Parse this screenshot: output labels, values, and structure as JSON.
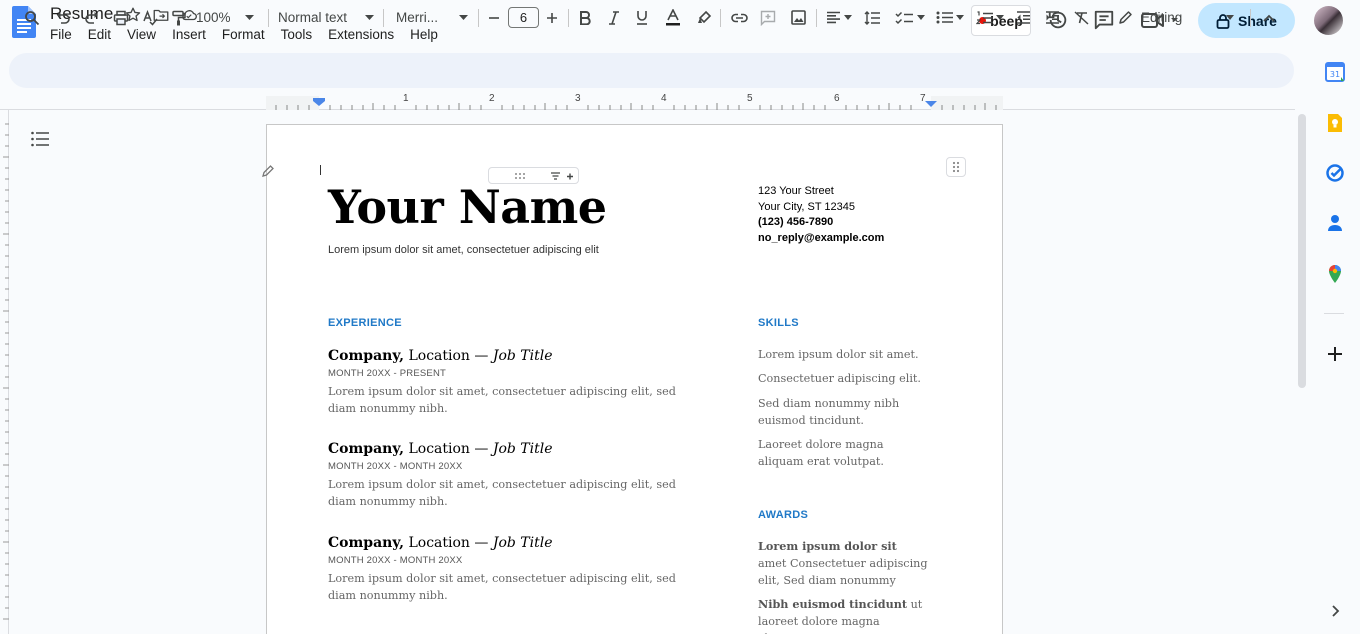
{
  "doc": {
    "title": "Resume",
    "menus": [
      "File",
      "Edit",
      "View",
      "Insert",
      "Format",
      "Tools",
      "Extensions",
      "Help"
    ]
  },
  "header": {
    "beep_label": "beep",
    "share_label": "Share"
  },
  "toolbar": {
    "zoom": "100%",
    "style": "Normal text",
    "font": "Merri...",
    "font_size": "6",
    "mode": "Editing"
  },
  "ruler": {
    "numbers": [
      "1",
      "2",
      "3",
      "4",
      "5",
      "6",
      "7"
    ]
  },
  "resume": {
    "name": "Your Name",
    "tagline": "Lorem ipsum dolor sit amet, consectetuer adipiscing elit",
    "address1": "123 Your Street",
    "address2": "Your City, ST 12345",
    "phone": "(123) 456-7890",
    "email": "no_reply@example.com",
    "experience_heading": "EXPERIENCE",
    "skills_heading": "SKILLS",
    "awards_heading": "AWARDS",
    "jobs": [
      {
        "company": "Company,",
        "location": " Location — ",
        "title": "Job Title",
        "dates": "MONTH 20XX - PRESENT",
        "desc": "Lorem ipsum dolor sit amet, consectetuer adipiscing elit, sed diam nonummy nibh."
      },
      {
        "company": "Company,",
        "location": " Location — ",
        "title": "Job Title",
        "dates": "MONTH 20XX - MONTH 20XX",
        "desc": "Lorem ipsum dolor sit amet, consectetuer adipiscing elit, sed diam nonummy nibh."
      },
      {
        "company": "Company,",
        "location": " Location — ",
        "title": "Job Title",
        "dates": "MONTH 20XX - MONTH 20XX",
        "desc": "Lorem ipsum dolor sit amet, consectetuer adipiscing elit, sed diam nonummy nibh."
      }
    ],
    "skills": [
      "Lorem ipsum dolor sit amet.",
      "Consectetuer adipiscing elit.",
      "Sed diam nonummy nibh euismod tincidunt.",
      "Laoreet dolore magna aliquam erat volutpat."
    ],
    "awards": [
      {
        "bold": "Lorem ipsum dolor sit",
        "rest": " amet Consectetuer adipiscing elit, Sed diam nonummy"
      },
      {
        "bold": "Nibh euismod tincidunt",
        "rest": " ut laoreet dolore magna aliquam"
      }
    ]
  },
  "colors": {
    "accent": "#2079c7",
    "share_bg": "#c2e7ff",
    "toolbar_bg": "#edf2fa",
    "docs_blue": "#4285f4"
  }
}
